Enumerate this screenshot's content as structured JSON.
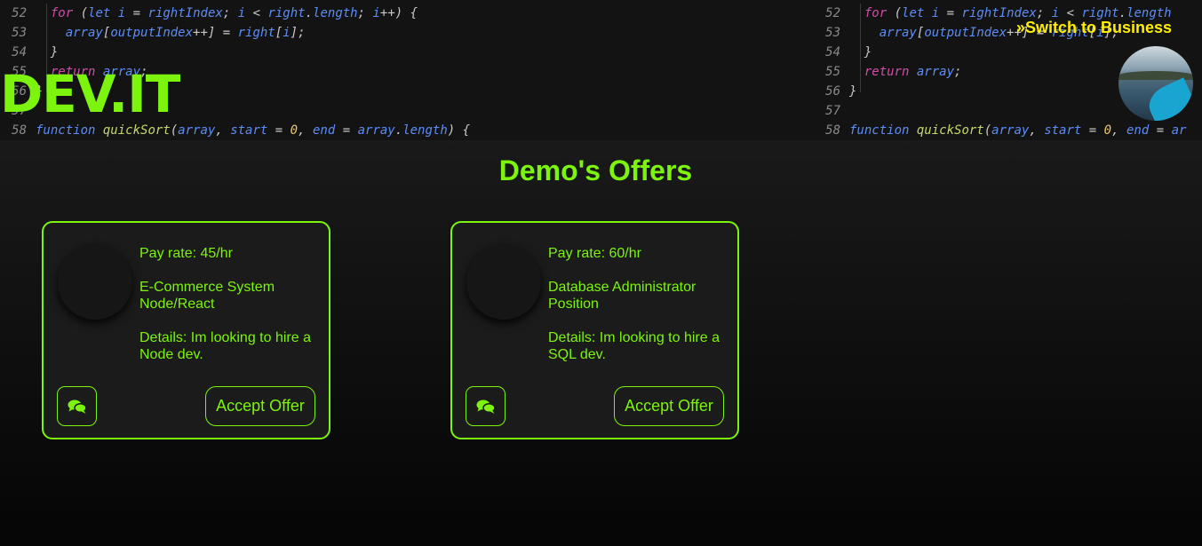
{
  "brand": {
    "logo": "DEV.IT",
    "accent": "#7cf40d",
    "switch_color": "#ffee00"
  },
  "header": {
    "switch_link": "»Switch to Business",
    "avatar_icon": "user-avatar"
  },
  "code_banner": {
    "left": [
      {
        "n": "52"
      },
      {
        "n": "53"
      },
      {
        "n": "54"
      },
      {
        "n": "55"
      },
      {
        "n": "56"
      },
      {
        "n": "57"
      },
      {
        "n": "58"
      }
    ],
    "right": [
      {
        "n": "52"
      },
      {
        "n": "53"
      },
      {
        "n": "54"
      },
      {
        "n": "55"
      },
      {
        "n": "56"
      },
      {
        "n": "57"
      },
      {
        "n": "58"
      }
    ],
    "tokens": {
      "for": "for",
      "let": "let",
      "i": "i",
      "rightIndex": "rightIndex",
      "right": "right",
      "length": "length",
      "array": "array",
      "outputIndex": "outputIndex",
      "return": "return",
      "function": "function",
      "quickSort": "quickSort",
      "start": "start",
      "end": "end",
      "zero": "0"
    }
  },
  "main": {
    "title": "Demo's Offers",
    "offers": [
      {
        "rate": "Pay rate: 45/hr",
        "project": "E-Commerce System Node/React",
        "details": "Details: Im looking to hire a Node dev.",
        "accept_label": "Accept Offer"
      },
      {
        "rate": "Pay rate: 60/hr",
        "project": "Database Administrator Position",
        "details": "Details: Im looking to hire a SQL dev.",
        "accept_label": "Accept Offer"
      }
    ]
  }
}
